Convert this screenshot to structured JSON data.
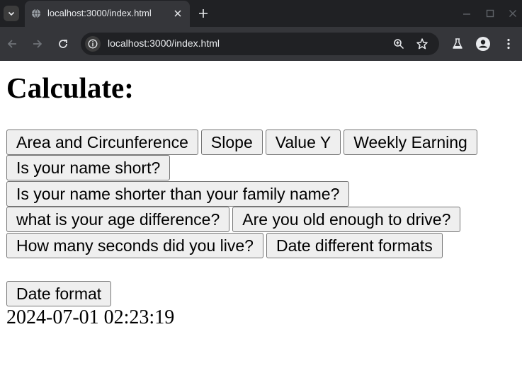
{
  "browser": {
    "tab": {
      "title": "localhost:3000/index.html"
    },
    "address_bar": {
      "url": "localhost:3000/index.html"
    }
  },
  "page": {
    "title": "Calculate:",
    "buttons": [
      "Area and Circunference",
      "Slope",
      "Value Y",
      "Weekly Earning",
      "Is your name short?",
      "Is your name shorter than your family name?",
      "what is your age difference?",
      "Are you old enough to drive?",
      "How many seconds did you live?",
      "Date different formats",
      "Date format"
    ],
    "result": "2024-07-01 02:23:19"
  },
  "icons": {
    "tab_search": "chevron-down-icon",
    "favicon": "globe-icon",
    "tab_close": "close-icon",
    "new_tab": "plus-icon",
    "back": "arrow-left-icon",
    "forward": "arrow-right-icon",
    "reload": "reload-icon",
    "site_info": "info-icon",
    "zoom": "zoom-icon",
    "bookmark": "star-icon",
    "labs": "flask-icon",
    "profile": "profile-icon",
    "menu": "kebab-menu-icon"
  },
  "colors": {
    "chrome_dark": "#202124",
    "chrome_toolbar": "#35363a",
    "button_bg": "#efefef",
    "button_border": "#767676"
  }
}
